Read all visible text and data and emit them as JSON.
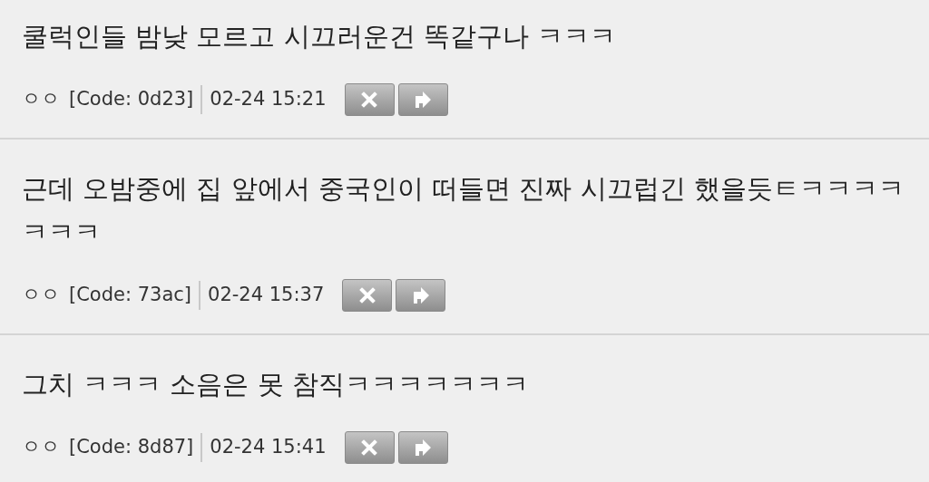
{
  "comments": [
    {
      "text": "쿨럭인들 밤낮 모르고 시끄러운건 똑같구나 ㅋㅋㅋ",
      "author": "ㅇㅇ",
      "code": "[Code: 0d23]",
      "time": "02-24 15:21"
    },
    {
      "text": "근데 오밤중에 집 앞에서 중국인이 떠들면 진짜 시끄럽긴 했을듯ㅌㅋㅋㅋㅋㅋㅋㅋ",
      "author": "ㅇㅇ",
      "code": "[Code: 73ac]",
      "time": "02-24 15:37"
    },
    {
      "text": "그치 ㅋㅋㅋ 소음은 못 참직ㅋㅋㅋㅋㅋㅋㅋ",
      "author": "ㅇㅇ",
      "code": "[Code: 8d87]",
      "time": "02-24 15:41"
    }
  ]
}
